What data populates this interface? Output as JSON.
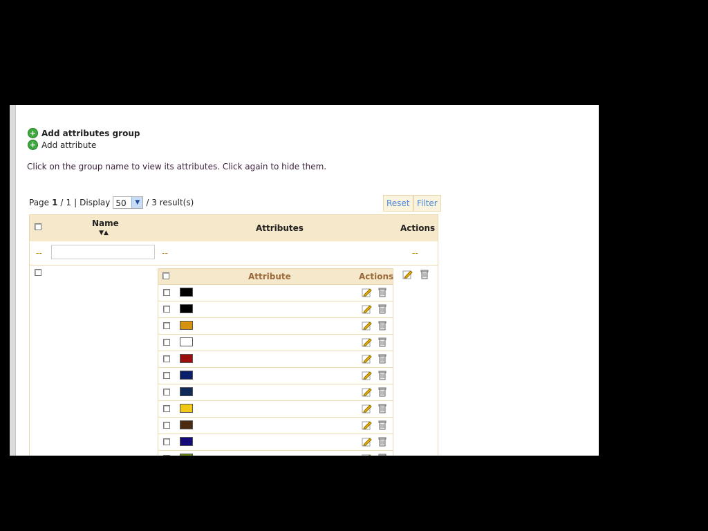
{
  "links": {
    "add_group": "Add attributes group",
    "add_attribute": "Add attribute"
  },
  "hint": "Click on the group name to view its attributes. Click again to hide them.",
  "pager": {
    "page_label": "Page",
    "current_page": "1",
    "total_pages": "1",
    "display_label": "Display",
    "per_page": "50",
    "results": "/ 3 result(s)"
  },
  "buttons": {
    "reset": "Reset",
    "filter": "Filter"
  },
  "table": {
    "headers": {
      "name": "Name",
      "attributes": "Attributes",
      "actions": "Actions"
    },
    "filter_placeholder": "--"
  },
  "subtable": {
    "headers": {
      "attribute": "Attribute",
      "actions": "Actions"
    },
    "swatches": [
      "#000000",
      "#000000",
      "#d4920e",
      "#ffffff",
      "#9a0e0e",
      "#0b1f6b",
      "#0f2a57",
      "#f0c814",
      "#4a2a10",
      "#140a7a",
      "#6b8a1e"
    ]
  },
  "icons": [
    "plus-icon",
    "edit-icon",
    "trash-icon",
    "sort-arrows-icon",
    "dropdown-arrow-icon"
  ]
}
